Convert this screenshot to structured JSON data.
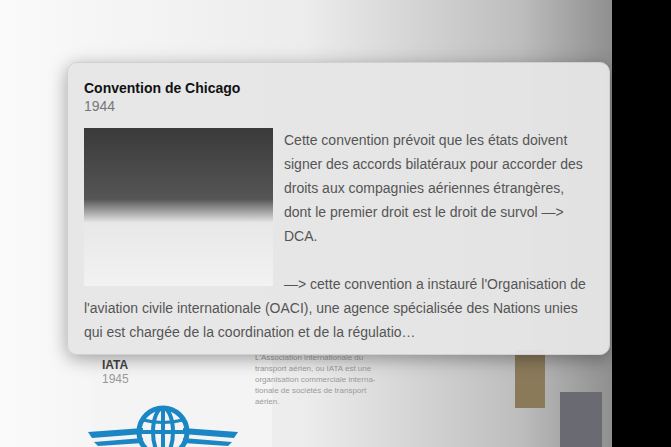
{
  "popup": {
    "title": "Convention de Chicago",
    "year": "1944",
    "paragraphs": [
      "Cette convention prévoit que les états doivent signer des accords bilatéraux pour accorder des droits aux compagnies aériennes étrangères, dont le premier droit est le droit de survol —> DCA.",
      "—> cette convention a instauré l'Organisation de l'aviation civile internationale (OACI), une agence spécialisée des Nations unies qui est chargée de la coordination et de la régulatio…"
    ]
  },
  "background_card": {
    "title": "IATA",
    "year": "1945",
    "lines": [
      "L'Association internationale du",
      "transport aérien, ou IATA est une",
      "organisation commerciale interna-",
      "tionale de sociétés de transport",
      "aérien."
    ]
  }
}
